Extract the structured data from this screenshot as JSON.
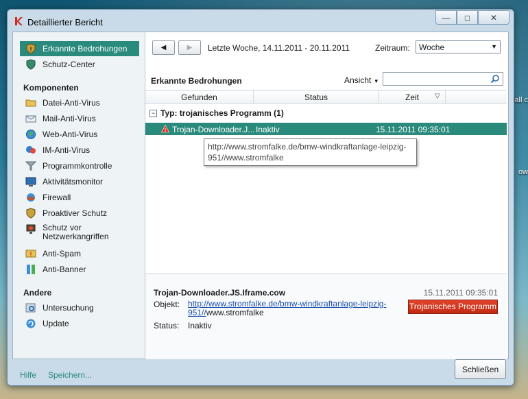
{
  "window": {
    "title": "Detaillierter Bericht"
  },
  "desktop": {
    "text1": "Call c",
    "text2": "ow"
  },
  "sidebar": {
    "top_items": [
      {
        "label": "Erkannte Bedrohungen",
        "active": true,
        "icon": "shield-alert-icon"
      },
      {
        "label": "Schutz-Center",
        "icon": "shield-icon"
      }
    ],
    "komponenten_title": "Komponenten",
    "komponenten": [
      {
        "label": "Datei-Anti-Virus",
        "icon": "folder-icon"
      },
      {
        "label": "Mail-Anti-Virus",
        "icon": "mail-icon"
      },
      {
        "label": "Web-Anti-Virus",
        "icon": "globe-icon"
      },
      {
        "label": "IM-Anti-Virus",
        "icon": "chat-icon"
      },
      {
        "label": "Programmkontrolle",
        "icon": "filter-icon"
      },
      {
        "label": "Aktivitätsmonitor",
        "icon": "monitor-icon"
      },
      {
        "label": "Firewall",
        "icon": "firewall-icon"
      },
      {
        "label": "Proaktiver Schutz",
        "icon": "shield-icon"
      },
      {
        "label": "Schutz vor Netzwerkangriffen",
        "label1": "Schutz vor",
        "label2": "Netzwerkangriffen",
        "icon": "network-shield-icon"
      },
      {
        "label": "Anti-Spam",
        "icon": "spam-icon"
      },
      {
        "label": "Anti-Banner",
        "icon": "banner-icon"
      }
    ],
    "andere_title": "Andere",
    "andere": [
      {
        "label": "Untersuchung",
        "icon": "scan-icon"
      },
      {
        "label": "Update",
        "icon": "update-icon"
      }
    ]
  },
  "toolbar": {
    "period": "Letzte Woche, 14.11.2011 - 20.11.2011",
    "zeitraum_label": "Zeitraum:",
    "zeitraum_value": "Woche"
  },
  "list": {
    "title": "Erkannte Bedrohungen",
    "ansicht": "Ansicht",
    "columns": [
      "Gefunden",
      "Status",
      "Zeit"
    ],
    "group": "Typ: trojanisches Programm (1)",
    "row": {
      "name": "Trojan-Downloader.J...",
      "status": "Inaktiv",
      "time": "15.11.2011 09:35:01"
    },
    "tooltip_line1": "http://www.stromfalke.de/bmw-windkraftanlage-leipzig-",
    "tooltip_line2": "951//www.stromfalke"
  },
  "detail": {
    "name": "Trojan-Downloader.JS.Iframe.cow",
    "date": "15.11.2011 09:35:01",
    "objekt_label": "Objekt:",
    "objekt_link1": "http://www.stromfalke.de/bmw-windkraftanlage-leipzig-",
    "objekt_link2": "951//",
    "objekt_rest": "www.stromfalke",
    "status_label": "Status:",
    "status_value": "Inaktiv",
    "type_badge": "Trojanisches Programm"
  },
  "footer": {
    "hilfe": "Hilfe",
    "speichern": "Speichern...",
    "close": "Schließen"
  },
  "colors": {
    "accent": "#2a8a7c",
    "danger": "#d4381f",
    "link": "#1a4fb0"
  }
}
